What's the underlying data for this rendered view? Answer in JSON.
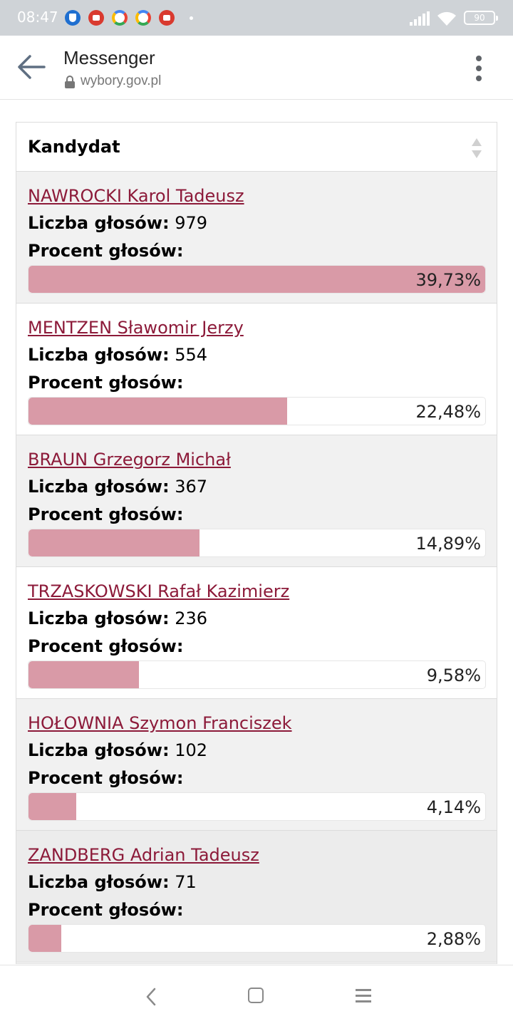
{
  "status_bar": {
    "time": "08:47",
    "battery": "90",
    "icons": [
      "shield-icon",
      "youtube-icon",
      "google-icon",
      "google-icon",
      "youtube-icon",
      "dot-icon",
      "signal-icon",
      "wifi-icon",
      "battery-icon"
    ]
  },
  "header": {
    "title": "Messenger",
    "url": "wybory.gov.pl"
  },
  "table": {
    "column_header": "Kandydat",
    "votes_label": "Liczba głosów:",
    "percent_label": "Procent głosów:",
    "bar_color": "#d99aa7",
    "name_color": "#8c1a39",
    "rows": [
      {
        "name": "NAWROCKI Karol Tadeusz",
        "votes": "979",
        "percent": "39,73%",
        "fraction": 1.0
      },
      {
        "name": "MENTZEN Sławomir Jerzy",
        "votes": "554",
        "percent": "22,48%",
        "fraction": 0.5658
      },
      {
        "name": "BRAUN Grzegorz Michał",
        "votes": "367",
        "percent": "14,89%",
        "fraction": 0.3748
      },
      {
        "name": "TRZASKOWSKI Rafał Kazimierz",
        "votes": "236",
        "percent": "9,58%",
        "fraction": 0.2411
      },
      {
        "name": "HOŁOWNIA Szymon Franciszek",
        "votes": "102",
        "percent": "4,14%",
        "fraction": 0.1042
      },
      {
        "name": "ZANDBERG Adrian Tadeusz",
        "votes": "71",
        "percent": "2,88%",
        "fraction": 0.0725
      }
    ]
  },
  "nav_bar": {
    "icons": [
      "back-icon",
      "home-icon",
      "recents-icon"
    ]
  }
}
